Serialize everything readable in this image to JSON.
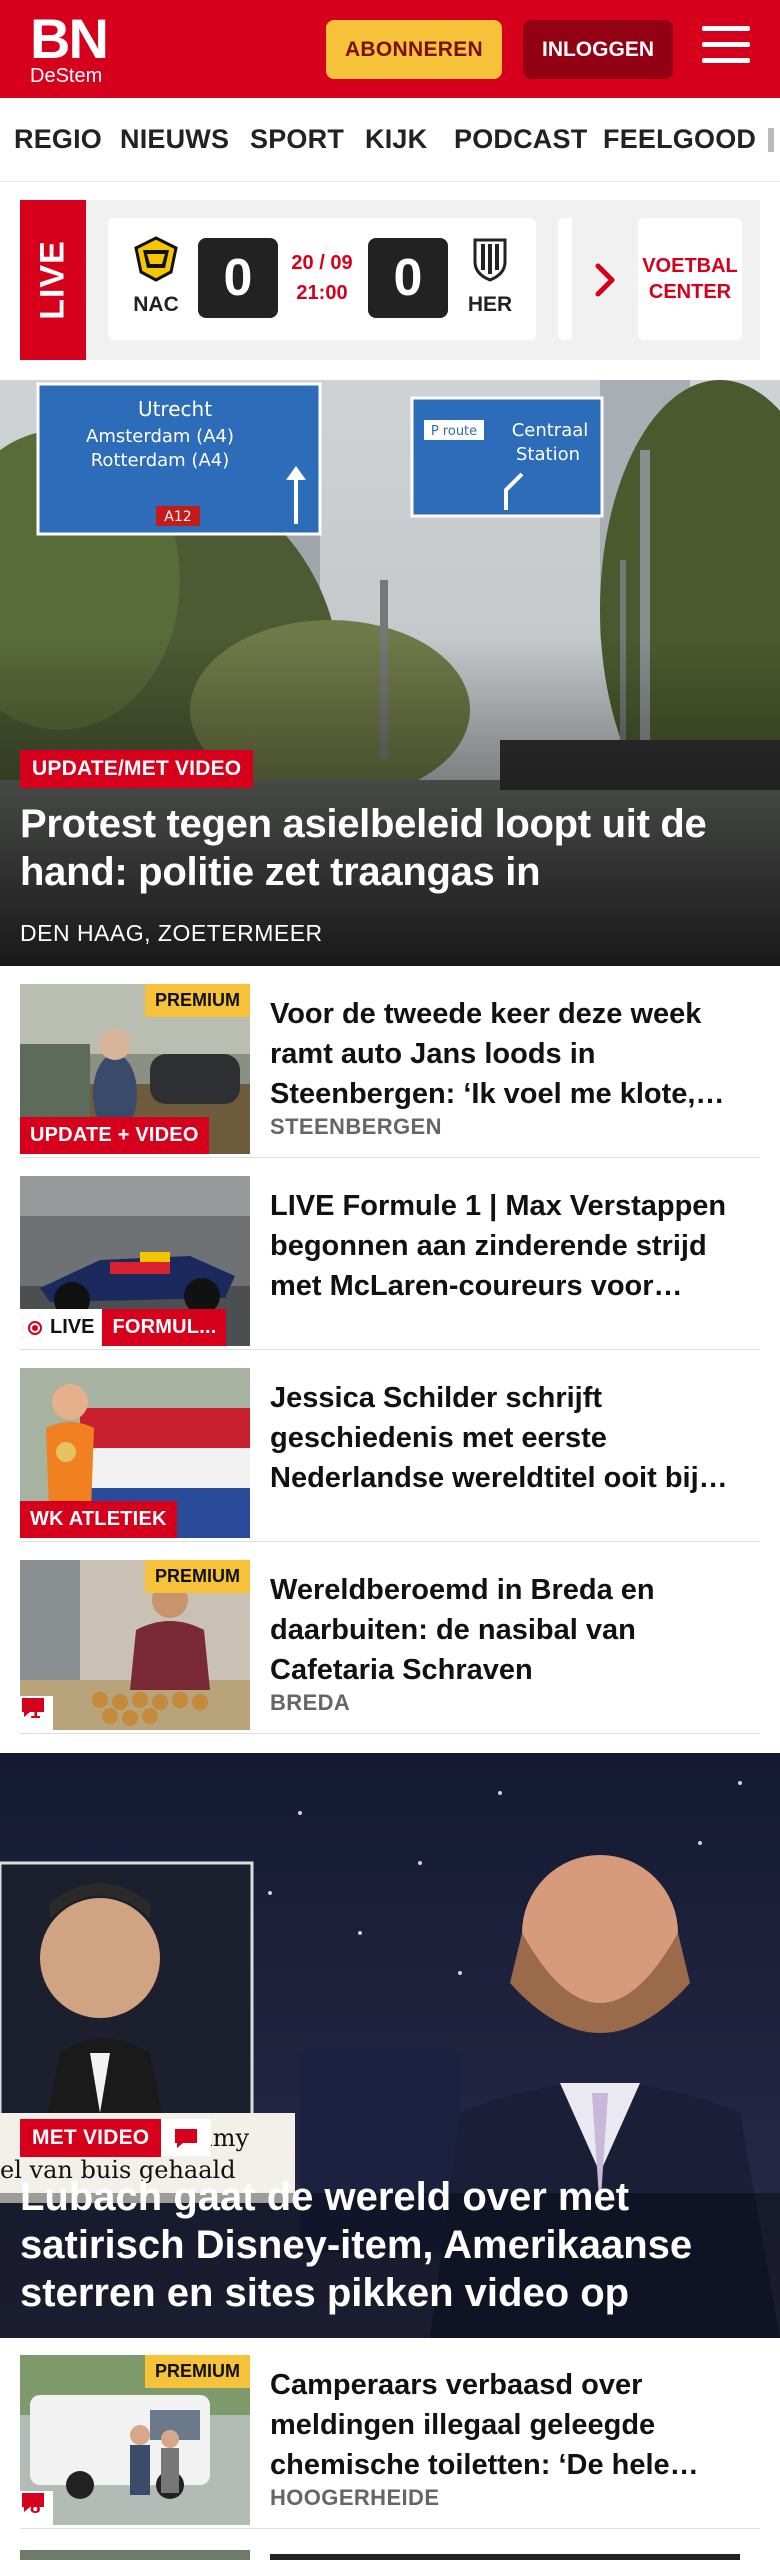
{
  "brand": {
    "name": "BN",
    "subname": "DeStem"
  },
  "header": {
    "subscribe_label": "ABONNEREN",
    "login_label": "INLOGGEN"
  },
  "nav": [
    "REGIO",
    "NIEUWS",
    "SPORT",
    "KIJK",
    "PODCAST",
    "FEELGOOD"
  ],
  "live": {
    "tag": "LIVE",
    "match": {
      "home": "NAC",
      "away": "HER",
      "home_score": "0",
      "away_score": "0",
      "date": "20 / 09",
      "time": "21:00"
    },
    "voetbal_center": "VOETBAL CENTER"
  },
  "hero": {
    "label": "UPDATE/MET VIDEO",
    "title": "Protest tegen asielbeleid loopt uit de hand: politie zet traangas in",
    "location": "DEN HAAG, ZOETERMEER",
    "sign_left": [
      "Utrecht",
      "Amsterdam (A4)",
      "Rotterdam (A4)",
      "A12"
    ],
    "sign_right": [
      "P route",
      "Centraal",
      "Station"
    ]
  },
  "articles": [
    {
      "title": "Voor de tweede keer deze week ramt auto Jans loods in Steenbergen: ‘Ik voel me klote,…",
      "location": "STEENBERGEN",
      "premium": "PREMIUM",
      "label": "UPDATE + VIDEO"
    },
    {
      "title": "LIVE Formule 1 | Max Verstappen begonnen aan zinderende strijd met McLaren-coureurs voor…",
      "live": "LIVE",
      "label": "FORMUL..."
    },
    {
      "title": "Jessica Schilder schrijft geschiedenis met eerste Nederlandse wereldtitel ooit bij…",
      "label": "WK ATLETIEK"
    },
    {
      "title": "Wereldberoemd in Breda en daarbuiten: de nasibal van Cafetaria Schraven",
      "location": "BREDA",
      "premium": "PREMIUM",
      "comments": "1"
    }
  ],
  "video_hero": {
    "label": "MET VIDEO",
    "title": "Lubach gaat de wereld over met satirisch Disney-item, Amerikaanse sterren en sites pikken video op",
    "overlay_text": [
      "mmy",
      "el van buis gehaald"
    ]
  },
  "article5": {
    "title": "Camperaars verbaasd over meldingen illegaal geleegde chemische toiletten: ‘De hele…",
    "location": "HOOGERHEIDE",
    "premium": "PREMIUM",
    "comments": "8"
  },
  "colors": {
    "brand_red": "#d6001c",
    "dark_red": "#930013",
    "premium_yellow": "#f5c23a"
  }
}
